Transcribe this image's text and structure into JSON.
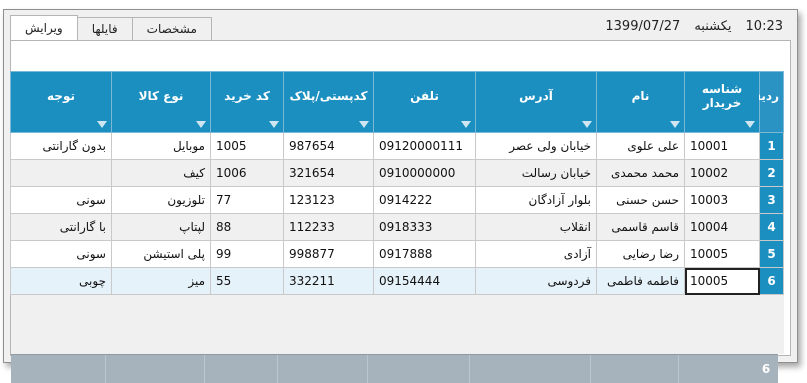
{
  "tabs": [
    {
      "label": "ویرایش",
      "active": true
    },
    {
      "label": "فایلها",
      "active": false
    },
    {
      "label": "مشخصات",
      "active": false
    }
  ],
  "datetime": {
    "time": "10:23",
    "day": "یکشنبه",
    "date": "1399/07/27"
  },
  "grid": {
    "headers": [
      "ردیف",
      "شناسه خریدار",
      "نام",
      "آدرس",
      "تلفن",
      "کدپستی/پلاک",
      "کد خرید",
      "نوع کالا",
      "توجه"
    ],
    "rows": [
      {
        "n": "1",
        "id": "10001",
        "name": "علی علوی",
        "addr": "خیابان ولی عصر",
        "tel": "09120000111",
        "postal": "987654",
        "code": "1005",
        "type": "موبایل",
        "note": "بدون گارانتی"
      },
      {
        "n": "2",
        "id": "10002",
        "name": "محمد محمدی",
        "addr": "خیابان رسالت",
        "tel": "0910000000",
        "postal": "321654",
        "code": "1006",
        "type": "کیف",
        "note": ""
      },
      {
        "n": "3",
        "id": "10003",
        "name": "حسن حسنی",
        "addr": "بلوار آزادگان",
        "tel": "0914222",
        "postal": "123123",
        "code": "77",
        "type": "تلوزیون",
        "note": "سونی"
      },
      {
        "n": "4",
        "id": "10004",
        "name": "قاسم قاسمی",
        "addr": "انقلاب",
        "tel": "0918333",
        "postal": "112233",
        "code": "88",
        "type": "لپتاپ",
        "note": "با گارانتی"
      },
      {
        "n": "5",
        "id": "10005",
        "name": "رضا رضایی",
        "addr": "آزادی",
        "tel": "0917888",
        "postal": "998877",
        "code": "99",
        "type": "پلی استیشن",
        "note": "سونی"
      },
      {
        "n": "6",
        "id": "10005",
        "name": "فاطمه فاطمی",
        "addr": "فردوسی",
        "tel": "09154444",
        "postal": "332211",
        "code": "55",
        "type": "میز",
        "note": "چوبی"
      }
    ],
    "footer_count": "6"
  }
}
